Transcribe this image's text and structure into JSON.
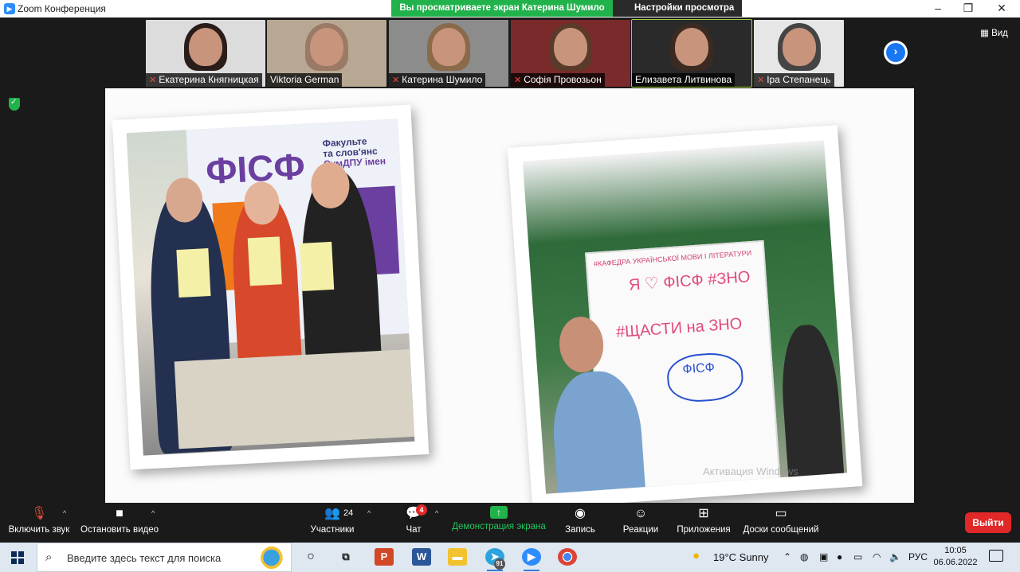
{
  "window": {
    "title": "Zoom Конференция",
    "share_notice": "Вы просматриваете экран Катерина Шумило",
    "view_options": "Настройки просмотра"
  },
  "participants": [
    {
      "name": "Екатерина Княгницкая",
      "muted": true,
      "active": false,
      "hair": "#2a1c18",
      "bg": "#dcdcdc"
    },
    {
      "name": "Viktoria German",
      "muted": false,
      "active": false,
      "hair": "#9a7a66",
      "bg": "#b8a893"
    },
    {
      "name": "Катерина Шумило",
      "muted": true,
      "active": false,
      "hair": "#8a6a4a",
      "bg": "#8c8c8c"
    },
    {
      "name": "Софія Провозьон",
      "muted": true,
      "active": false,
      "hair": "#5a3a2a",
      "bg": "#7a2a2a"
    },
    {
      "name": "Елизавета Литвинова",
      "muted": false,
      "active": true,
      "hair": "#3b2a22",
      "bg": "#2a2a2a"
    },
    {
      "name": "Іра Степанець",
      "muted": true,
      "active": false,
      "hair": "#444444",
      "bg": "#e6e6e6"
    }
  ],
  "view_button": "Вид",
  "slide": {
    "logo_text": "ФІСФ",
    "faculty_text_1": "Факульте",
    "faculty_text_2": "та слов'янс",
    "faculty_text_3": "СумДПУ імен",
    "board_heading": "#КАФЕДРА УКРАЇНСЬКОЇ МОВИ І ЛІТЕРАТУРИ",
    "board_line_1": "Я ♡ ФІСФ #ЗНО",
    "board_line_2": "#ЩАСТИ на ЗНО",
    "board_cloud": "ФІСФ",
    "watermark": "Активация Windows"
  },
  "toolbar": {
    "audio": "Включить звук",
    "video": "Остановить видео",
    "participants": "Участники",
    "participants_count": "24",
    "chat": "Чат",
    "chat_badge": "4",
    "share": "Демонстрация экрана",
    "record": "Запись",
    "reactions": "Реакции",
    "apps": "Приложения",
    "whiteboards": "Доски сообщений",
    "leave": "Выйти"
  },
  "taskbar": {
    "search_placeholder": "Введите здесь текст для поиска",
    "telegram_badge": "91",
    "weather": "19°C  Sunny",
    "lang": "РУС",
    "time": "10:05",
    "date": "06.06.2022"
  }
}
